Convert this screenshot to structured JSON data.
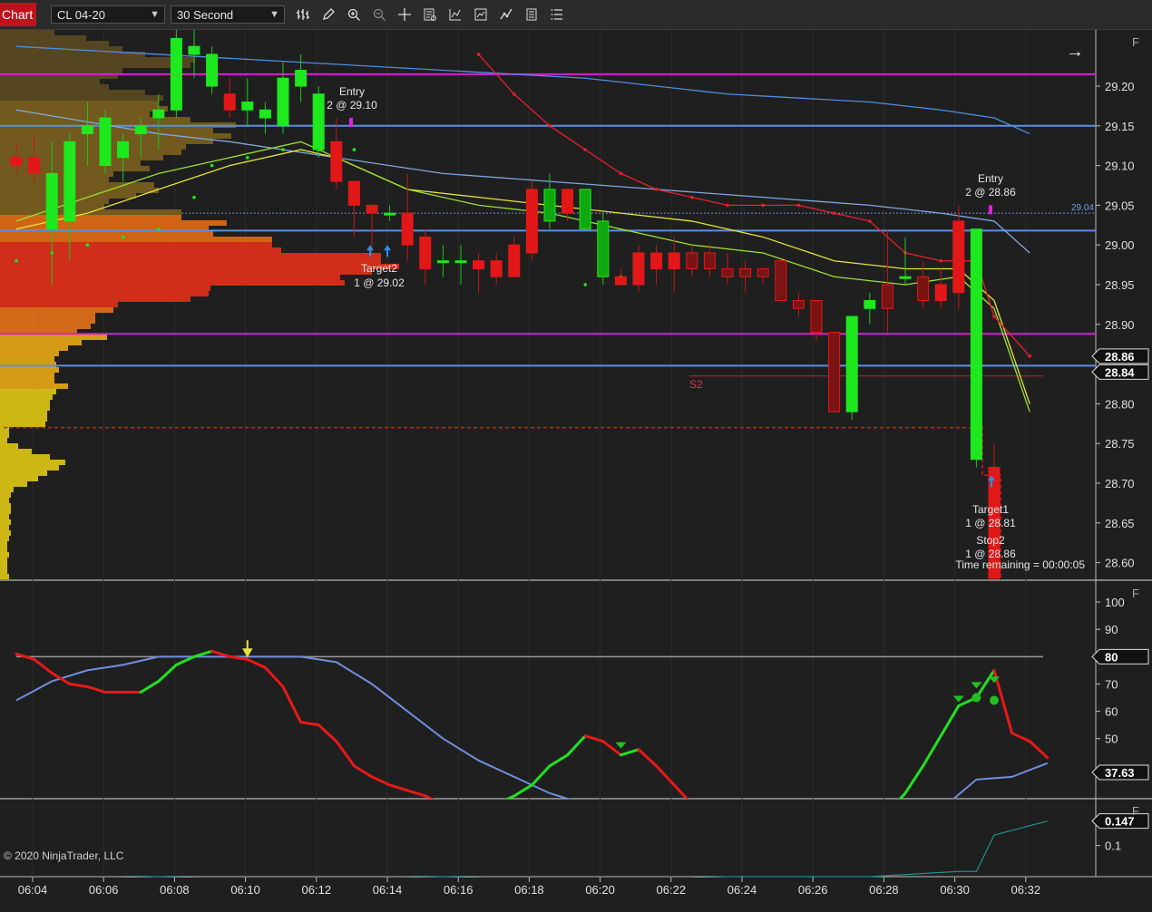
{
  "toolbar": {
    "chart_tab_label": "Chart",
    "instrument": "CL 04-20",
    "interval": "30 Second",
    "icons": [
      "bar-style-icon",
      "draw-pencil-icon",
      "zoom-in-icon",
      "zoom-out-icon",
      "crosshair-icon",
      "data-box-icon",
      "indicators-icon",
      "strategies-icon",
      "templates-icon",
      "properties-icon"
    ]
  },
  "colors": {
    "bg": "#1f1f1f",
    "magenta": "#d81fd0",
    "blue_line": "#5b8fe0",
    "bull": "#1ee81e",
    "bear": "#e21818",
    "sma_red": "#e8202a"
  },
  "price_panel": {
    "y_ticks": [
      "29.20",
      "29.15",
      "29.10",
      "29.05",
      "29.00",
      "28.95",
      "28.90",
      "28.80",
      "28.75",
      "28.70",
      "28.65",
      "28.60"
    ],
    "price_boxes": [
      "28.86",
      "28.84"
    ],
    "level_label": "29.04",
    "f_label": "F",
    "arrow_icon": "→",
    "annotations": {
      "entry1_title": "Entry",
      "entry1_sub": "2 @ 29.10",
      "target_left_a": "Target2",
      "target_left_b": "1 @ 29.02",
      "entry2_title": "Entry",
      "entry2_sub": "2 @ 28.86",
      "target1_title": "Target1",
      "target1_sub": "1 @ 28.81",
      "stop2_title": "Stop2",
      "stop2_sub": "1 @ 28.86",
      "s2": "S2",
      "time_remaining": "Time remaining = 00:00:05"
    }
  },
  "osc_panel": {
    "y_ticks": [
      "100",
      "90",
      "70",
      "60",
      "50"
    ],
    "boxes": [
      "80",
      "37.63"
    ],
    "f_label": "F"
  },
  "vol_panel": {
    "y_ticks": [
      "0.1"
    ],
    "box": "0.147",
    "f_label": "F",
    "copyright": "© 2020 NinjaTrader, LLC"
  },
  "x_axis": {
    "labels": [
      "06:04",
      "06:06",
      "06:08",
      "06:10",
      "06:12",
      "06:14",
      "06:16",
      "06:18",
      "06:20",
      "06:22",
      "06:24",
      "06:26",
      "06:28",
      "06:30",
      "06:32"
    ]
  },
  "chart_data": {
    "type": "candlestick",
    "instrument": "CL 04-20",
    "interval": "30 Second",
    "ylim": [
      28.58,
      29.26
    ],
    "horizontal_lines": [
      29.215,
      29.15,
      29.018,
      28.888,
      28.848
    ],
    "candles": [
      {
        "t": "06:04:00",
        "o": 29.11,
        "h": 29.13,
        "l": 29.09,
        "c": 29.1
      },
      {
        "t": "06:04:30",
        "o": 29.11,
        "h": 29.14,
        "l": 29.08,
        "c": 29.09
      },
      {
        "t": "06:05:00",
        "o": 29.02,
        "h": 29.13,
        "l": 28.95,
        "c": 29.09
      },
      {
        "t": "06:05:30",
        "o": 29.03,
        "h": 29.14,
        "l": 28.98,
        "c": 29.13
      },
      {
        "t": "06:06:00",
        "o": 29.14,
        "h": 29.18,
        "l": 29.1,
        "c": 29.15
      },
      {
        "t": "06:06:30",
        "o": 29.1,
        "h": 29.17,
        "l": 29.09,
        "c": 29.16
      },
      {
        "t": "06:07:00",
        "o": 29.11,
        "h": 29.14,
        "l": 29.08,
        "c": 29.13
      },
      {
        "t": "06:07:30",
        "o": 29.14,
        "h": 29.16,
        "l": 29.11,
        "c": 29.15
      },
      {
        "t": "06:08:00",
        "o": 29.16,
        "h": 29.19,
        "l": 29.12,
        "c": 29.17
      },
      {
        "t": "06:08:30",
        "o": 29.17,
        "h": 29.3,
        "l": 29.16,
        "c": 29.26
      },
      {
        "t": "06:09:00",
        "o": 29.24,
        "h": 29.28,
        "l": 29.21,
        "c": 29.25
      },
      {
        "t": "06:09:30",
        "o": 29.2,
        "h": 29.25,
        "l": 29.19,
        "c": 29.24
      },
      {
        "t": "06:10:00",
        "o": 29.19,
        "h": 29.21,
        "l": 29.16,
        "c": 29.17
      },
      {
        "t": "06:10:30",
        "o": 29.17,
        "h": 29.21,
        "l": 29.15,
        "c": 29.18
      },
      {
        "t": "06:11:00",
        "o": 29.16,
        "h": 29.18,
        "l": 29.14,
        "c": 29.17
      },
      {
        "t": "06:11:30",
        "o": 29.15,
        "h": 29.23,
        "l": 29.14,
        "c": 29.21
      },
      {
        "t": "06:12:00",
        "o": 29.2,
        "h": 29.24,
        "l": 29.18,
        "c": 29.22
      },
      {
        "t": "06:12:30",
        "o": 29.12,
        "h": 29.2,
        "l": 29.11,
        "c": 29.19
      },
      {
        "t": "06:13:00",
        "o": 29.13,
        "h": 29.16,
        "l": 29.07,
        "c": 29.08
      },
      {
        "t": "06:13:30",
        "o": 29.08,
        "h": 29.08,
        "l": 29.01,
        "c": 29.05
      },
      {
        "t": "06:14:00",
        "o": 29.05,
        "h": 29.05,
        "l": 28.99,
        "c": 29.04
      },
      {
        "t": "06:14:30",
        "o": 29.04,
        "h": 29.05,
        "l": 29.03,
        "c": 29.04
      },
      {
        "t": "06:15:00",
        "o": 29.04,
        "h": 29.09,
        "l": 28.98,
        "c": 29.0
      },
      {
        "t": "06:15:30",
        "o": 29.01,
        "h": 29.02,
        "l": 28.95,
        "c": 28.97
      },
      {
        "t": "06:16:00",
        "o": 28.98,
        "h": 29.0,
        "l": 28.96,
        "c": 28.98
      },
      {
        "t": "06:16:30",
        "o": 28.98,
        "h": 29.0,
        "l": 28.95,
        "c": 28.98
      },
      {
        "t": "06:17:00",
        "o": 28.98,
        "h": 28.99,
        "l": 28.94,
        "c": 28.97
      },
      {
        "t": "06:17:30",
        "o": 28.98,
        "h": 28.99,
        "l": 28.95,
        "c": 28.96
      },
      {
        "t": "06:18:00",
        "o": 29.0,
        "h": 29.01,
        "l": 28.96,
        "c": 28.96
      },
      {
        "t": "06:18:30",
        "o": 29.07,
        "h": 29.08,
        "l": 28.98,
        "c": 28.99
      },
      {
        "t": "06:19:00",
        "o": 29.03,
        "h": 29.09,
        "l": 29.02,
        "c": 29.07
      },
      {
        "t": "06:19:30",
        "o": 29.07,
        "h": 29.07,
        "l": 29.03,
        "c": 29.04
      },
      {
        "t": "06:20:00",
        "o": 29.02,
        "h": 29.07,
        "l": 29.02,
        "c": 29.07
      },
      {
        "t": "06:20:30",
        "o": 28.96,
        "h": 29.04,
        "l": 28.95,
        "c": 29.03
      },
      {
        "t": "06:21:00",
        "o": 28.96,
        "h": 28.97,
        "l": 28.95,
        "c": 28.95
      },
      {
        "t": "06:21:30",
        "o": 28.99,
        "h": 29.0,
        "l": 28.94,
        "c": 28.95
      },
      {
        "t": "06:22:00",
        "o": 28.99,
        "h": 29.0,
        "l": 28.95,
        "c": 28.97
      },
      {
        "t": "06:22:30",
        "o": 28.99,
        "h": 29.01,
        "l": 28.94,
        "c": 28.97
      },
      {
        "t": "06:23:00",
        "o": 28.99,
        "h": 29.0,
        "l": 28.96,
        "c": 28.97
      },
      {
        "t": "06:23:30",
        "o": 28.99,
        "h": 29.0,
        "l": 28.96,
        "c": 28.97
      },
      {
        "t": "06:24:00",
        "o": 28.97,
        "h": 28.99,
        "l": 28.95,
        "c": 28.96
      },
      {
        "t": "06:24:30",
        "o": 28.97,
        "h": 28.98,
        "l": 28.94,
        "c": 28.96
      },
      {
        "t": "06:25:00",
        "o": 28.97,
        "h": 28.97,
        "l": 28.95,
        "c": 28.96
      },
      {
        "t": "06:25:30",
        "o": 28.98,
        "h": 28.98,
        "l": 28.93,
        "c": 28.93
      },
      {
        "t": "06:26:00",
        "o": 28.93,
        "h": 28.94,
        "l": 28.91,
        "c": 28.92
      },
      {
        "t": "06:26:30",
        "o": 28.93,
        "h": 28.93,
        "l": 28.88,
        "c": 28.89
      },
      {
        "t": "06:27:00",
        "o": 28.89,
        "h": 28.89,
        "l": 28.79,
        "c": 28.79
      },
      {
        "t": "06:27:30",
        "o": 28.79,
        "h": 28.91,
        "l": 28.78,
        "c": 28.91
      },
      {
        "t": "06:28:00",
        "o": 28.92,
        "h": 28.94,
        "l": 28.9,
        "c": 28.93
      },
      {
        "t": "06:28:30",
        "o": 28.95,
        "h": 29.02,
        "l": 28.89,
        "c": 28.92
      },
      {
        "t": "06:29:00",
        "o": 28.96,
        "h": 29.01,
        "l": 28.95,
        "c": 28.96
      },
      {
        "t": "06:29:30",
        "o": 28.96,
        "h": 28.98,
        "l": 28.92,
        "c": 28.93
      },
      {
        "t": "06:30:00",
        "o": 28.95,
        "h": 28.97,
        "l": 28.92,
        "c": 28.93
      },
      {
        "t": "06:30:30",
        "o": 29.03,
        "h": 29.05,
        "l": 28.92,
        "c": 28.94
      },
      {
        "t": "06:31:00",
        "o": 28.73,
        "h": 29.02,
        "l": 28.72,
        "c": 29.02
      },
      {
        "t": "06:31:30",
        "o": 28.72,
        "h": 28.75,
        "l": 28.58,
        "c": 28.58
      }
    ],
    "sma_red": [
      [
        26,
        29.24
      ],
      [
        28,
        29.19
      ],
      [
        30,
        29.15
      ],
      [
        32,
        29.12
      ],
      [
        34,
        29.09
      ],
      [
        36,
        29.07
      ],
      [
        38,
        29.06
      ],
      [
        40,
        29.05
      ],
      [
        42,
        29.05
      ],
      [
        44,
        29.05
      ],
      [
        46,
        29.04
      ],
      [
        48,
        29.03
      ],
      [
        50,
        28.99
      ],
      [
        52,
        28.98
      ],
      [
        54,
        28.98
      ],
      [
        55,
        28.91
      ],
      [
        57,
        28.86
      ]
    ],
    "ema_yellow": [
      [
        0,
        29.02
      ],
      [
        4,
        29.04
      ],
      [
        8,
        29.07
      ],
      [
        12,
        29.1
      ],
      [
        16,
        29.12
      ],
      [
        18,
        29.11
      ],
      [
        22,
        29.07
      ],
      [
        26,
        29.06
      ],
      [
        30,
        29.05
      ],
      [
        34,
        29.04
      ],
      [
        38,
        29.03
      ],
      [
        42,
        29.01
      ],
      [
        46,
        28.98
      ],
      [
        50,
        28.97
      ],
      [
        53,
        28.97
      ],
      [
        55,
        28.93
      ],
      [
        57,
        28.8
      ]
    ],
    "ema_green": [
      [
        0,
        29.03
      ],
      [
        4,
        29.06
      ],
      [
        8,
        29.09
      ],
      [
        12,
        29.11
      ],
      [
        16,
        29.13
      ],
      [
        18,
        29.11
      ],
      [
        22,
        29.07
      ],
      [
        26,
        29.05
      ],
      [
        30,
        29.04
      ],
      [
        34,
        29.02
      ],
      [
        38,
        29.0
      ],
      [
        42,
        28.99
      ],
      [
        46,
        28.96
      ],
      [
        50,
        28.95
      ],
      [
        53,
        28.96
      ],
      [
        55,
        28.92
      ],
      [
        57,
        28.79
      ]
    ],
    "sma_blue": [
      [
        0,
        29.25
      ],
      [
        8,
        29.24
      ],
      [
        16,
        29.23
      ],
      [
        24,
        29.22
      ],
      [
        32,
        29.21
      ],
      [
        40,
        29.19
      ],
      [
        48,
        29.18
      ],
      [
        52,
        29.17
      ],
      [
        55,
        29.16
      ],
      [
        57,
        29.14
      ]
    ],
    "sma_lightblue": [
      [
        0,
        29.17
      ],
      [
        8,
        29.14
      ],
      [
        12,
        29.13
      ],
      [
        18,
        29.11
      ],
      [
        24,
        29.09
      ],
      [
        30,
        29.08
      ],
      [
        36,
        29.07
      ],
      [
        42,
        29.06
      ],
      [
        48,
        29.05
      ],
      [
        52,
        29.04
      ],
      [
        55,
        29.03
      ],
      [
        57,
        28.99
      ]
    ],
    "oscillator_red": [
      [
        0,
        81
      ],
      [
        1,
        79
      ],
      [
        2,
        74
      ],
      [
        3,
        70
      ],
      [
        4,
        69
      ],
      [
        5,
        67
      ],
      [
        6,
        67
      ],
      [
        7,
        67
      ],
      [
        8,
        71
      ],
      [
        9,
        77
      ],
      [
        10,
        80
      ],
      [
        11,
        82
      ],
      [
        12,
        80
      ],
      [
        13,
        79
      ],
      [
        14,
        76
      ],
      [
        15,
        69
      ],
      [
        16,
        56
      ],
      [
        17,
        55
      ],
      [
        18,
        49
      ],
      [
        19,
        40
      ],
      [
        20,
        36
      ],
      [
        21,
        33
      ],
      [
        22,
        31
      ],
      [
        23,
        29
      ],
      [
        24,
        26
      ],
      [
        25,
        24
      ],
      [
        26,
        24
      ],
      [
        27,
        26
      ],
      [
        28,
        29
      ],
      [
        29,
        33
      ],
      [
        30,
        40
      ],
      [
        31,
        44
      ],
      [
        32,
        51
      ],
      [
        33,
        49
      ],
      [
        34,
        44
      ],
      [
        35,
        46
      ],
      [
        36,
        40
      ],
      [
        37,
        33
      ],
      [
        38,
        26
      ],
      [
        39,
        24
      ],
      [
        40,
        22
      ],
      [
        41,
        22
      ],
      [
        42,
        20
      ],
      [
        43,
        18
      ],
      [
        44,
        16
      ],
      [
        45,
        15
      ],
      [
        46,
        15
      ],
      [
        47,
        16
      ],
      [
        48,
        18
      ],
      [
        49,
        23
      ],
      [
        50,
        30
      ],
      [
        51,
        40
      ],
      [
        52,
        51
      ],
      [
        53,
        62
      ],
      [
        54,
        65
      ],
      [
        55,
        75
      ],
      [
        56,
        52
      ],
      [
        57,
        49
      ],
      [
        58,
        43
      ]
    ],
    "oscillator_blue": [
      [
        0,
        64
      ],
      [
        2,
        71
      ],
      [
        4,
        75
      ],
      [
        6,
        77
      ],
      [
        8,
        80
      ],
      [
        10,
        80
      ],
      [
        12,
        80
      ],
      [
        14,
        80
      ],
      [
        16,
        80
      ],
      [
        18,
        78
      ],
      [
        20,
        70
      ],
      [
        22,
        60
      ],
      [
        24,
        50
      ],
      [
        26,
        42
      ],
      [
        28,
        36
      ],
      [
        30,
        30
      ],
      [
        32,
        26
      ],
      [
        34,
        22
      ],
      [
        36,
        19
      ],
      [
        38,
        16
      ],
      [
        40,
        14
      ],
      [
        42,
        12
      ],
      [
        44,
        11
      ],
      [
        46,
        11
      ],
      [
        48,
        12
      ],
      [
        50,
        16
      ],
      [
        52,
        24
      ],
      [
        54,
        35
      ],
      [
        56,
        36
      ],
      [
        58,
        41
      ]
    ],
    "oscillator_level": 80,
    "oscillator_ylim": [
      28,
      108
    ],
    "volume_line": [
      [
        0,
        0.03
      ],
      [
        8,
        0.04
      ],
      [
        16,
        0.03
      ],
      [
        24,
        0.04
      ],
      [
        32,
        0.03
      ],
      [
        40,
        0.04
      ],
      [
        48,
        0.04
      ],
      [
        53,
        0.05
      ],
      [
        54,
        0.05
      ],
      [
        55,
        0.12
      ],
      [
        58,
        0.147
      ]
    ],
    "volume_ylim": [
      0.04,
      0.19
    ]
  }
}
